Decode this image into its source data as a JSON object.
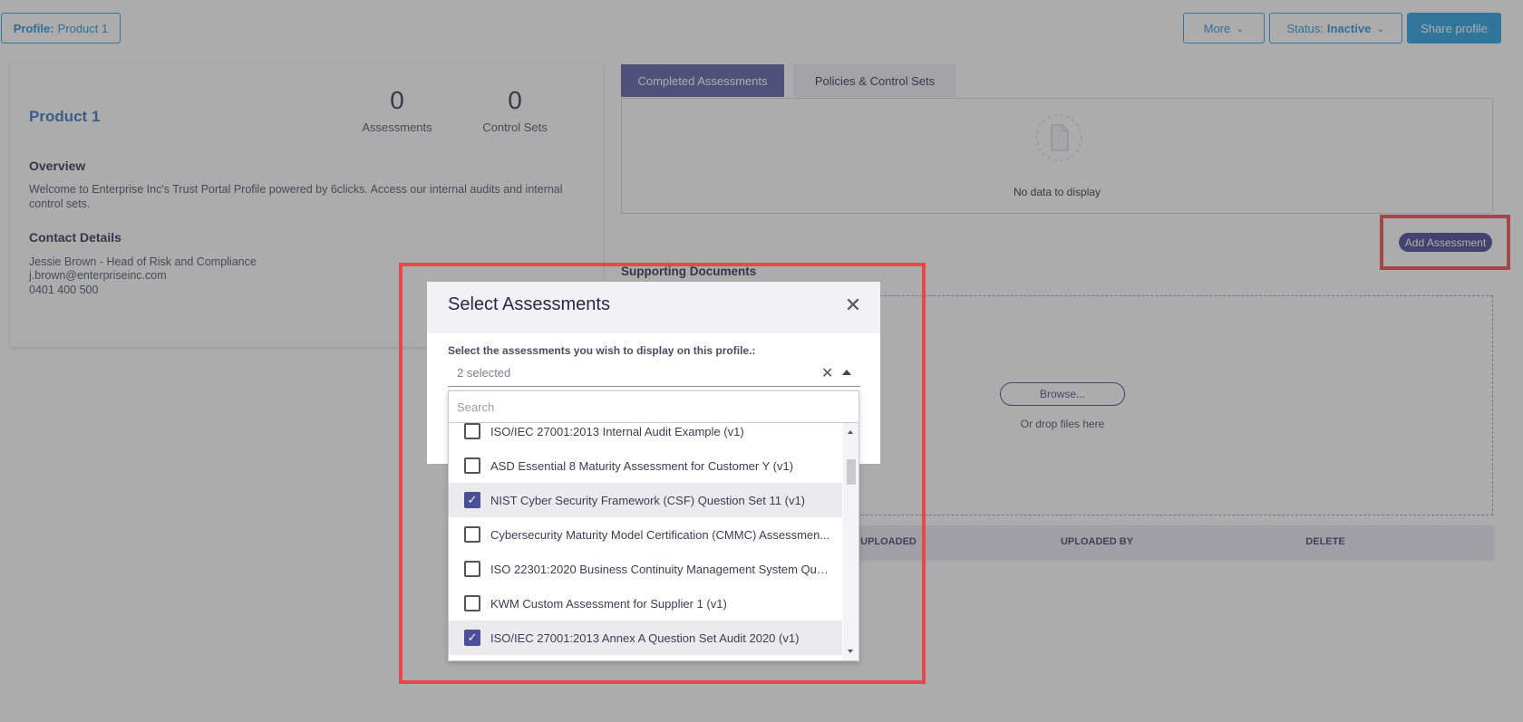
{
  "topbar": {
    "profile_prefix": "Profile:",
    "profile_name": "Product 1",
    "more_label": "More",
    "status_prefix": "Status:",
    "status_value": "Inactive",
    "share_label": "Share profile"
  },
  "profile_card": {
    "title": "Product 1",
    "stats": [
      {
        "value": "0",
        "label": "Assessments"
      },
      {
        "value": "0",
        "label": "Control Sets"
      }
    ],
    "overview_heading": "Overview",
    "overview_line1": "Welcome to Enterprise Inc's Trust Portal Profile powered by 6clicks. Access our internal audits and internal",
    "overview_line2": "control sets.",
    "contact_heading": "Contact Details",
    "contact_name": "Jessie Brown - Head of Risk and Compliance",
    "contact_email": "j.brown@enterpriseinc.com",
    "contact_phone": "0401 400 500"
  },
  "tabs": [
    {
      "label": "Completed Assessments",
      "active": true
    },
    {
      "label": "Policies & Control Sets",
      "active": false
    }
  ],
  "assessments_panel": {
    "empty_text": "No data to display",
    "add_button": "Add Assessment"
  },
  "documents": {
    "heading": "Supporting Documents",
    "browse_button": "Browse...",
    "drop_text": "Or drop files here",
    "columns": [
      "UPLOADED",
      "UPLOADED BY",
      "DELETE"
    ]
  },
  "modal": {
    "title": "Select Assessments",
    "field_label": "Select the assessments you wish to display on this profile.:",
    "selected_summary": "2 selected",
    "search_placeholder": "Search",
    "options": [
      {
        "label": "ISO/IEC 27001:2013 Internal Audit Example (v1)",
        "checked": false
      },
      {
        "label": "ASD Essential 8 Maturity Assessment for Customer Y (v1)",
        "checked": false
      },
      {
        "label": "NIST Cyber Security Framework (CSF) Question Set 11 (v1)",
        "checked": true
      },
      {
        "label": "Cybersecurity Maturity Model Certification (CMMC) Assessmen...",
        "checked": false
      },
      {
        "label": "ISO 22301:2020 Business Continuity Management System Que...",
        "checked": false
      },
      {
        "label": "KWM Custom Assessment for Supplier 1 (v1)",
        "checked": false
      },
      {
        "label": "ISO/IEC 27001:2013 Annex A Question Set Audit 2020 (v1)",
        "checked": true
      }
    ]
  },
  "colors": {
    "accent_blue": "#1e9ddf",
    "tab_active": "#565aa6",
    "checkbox_checked": "#4b4f9a",
    "highlight_red": "#e8474b"
  }
}
